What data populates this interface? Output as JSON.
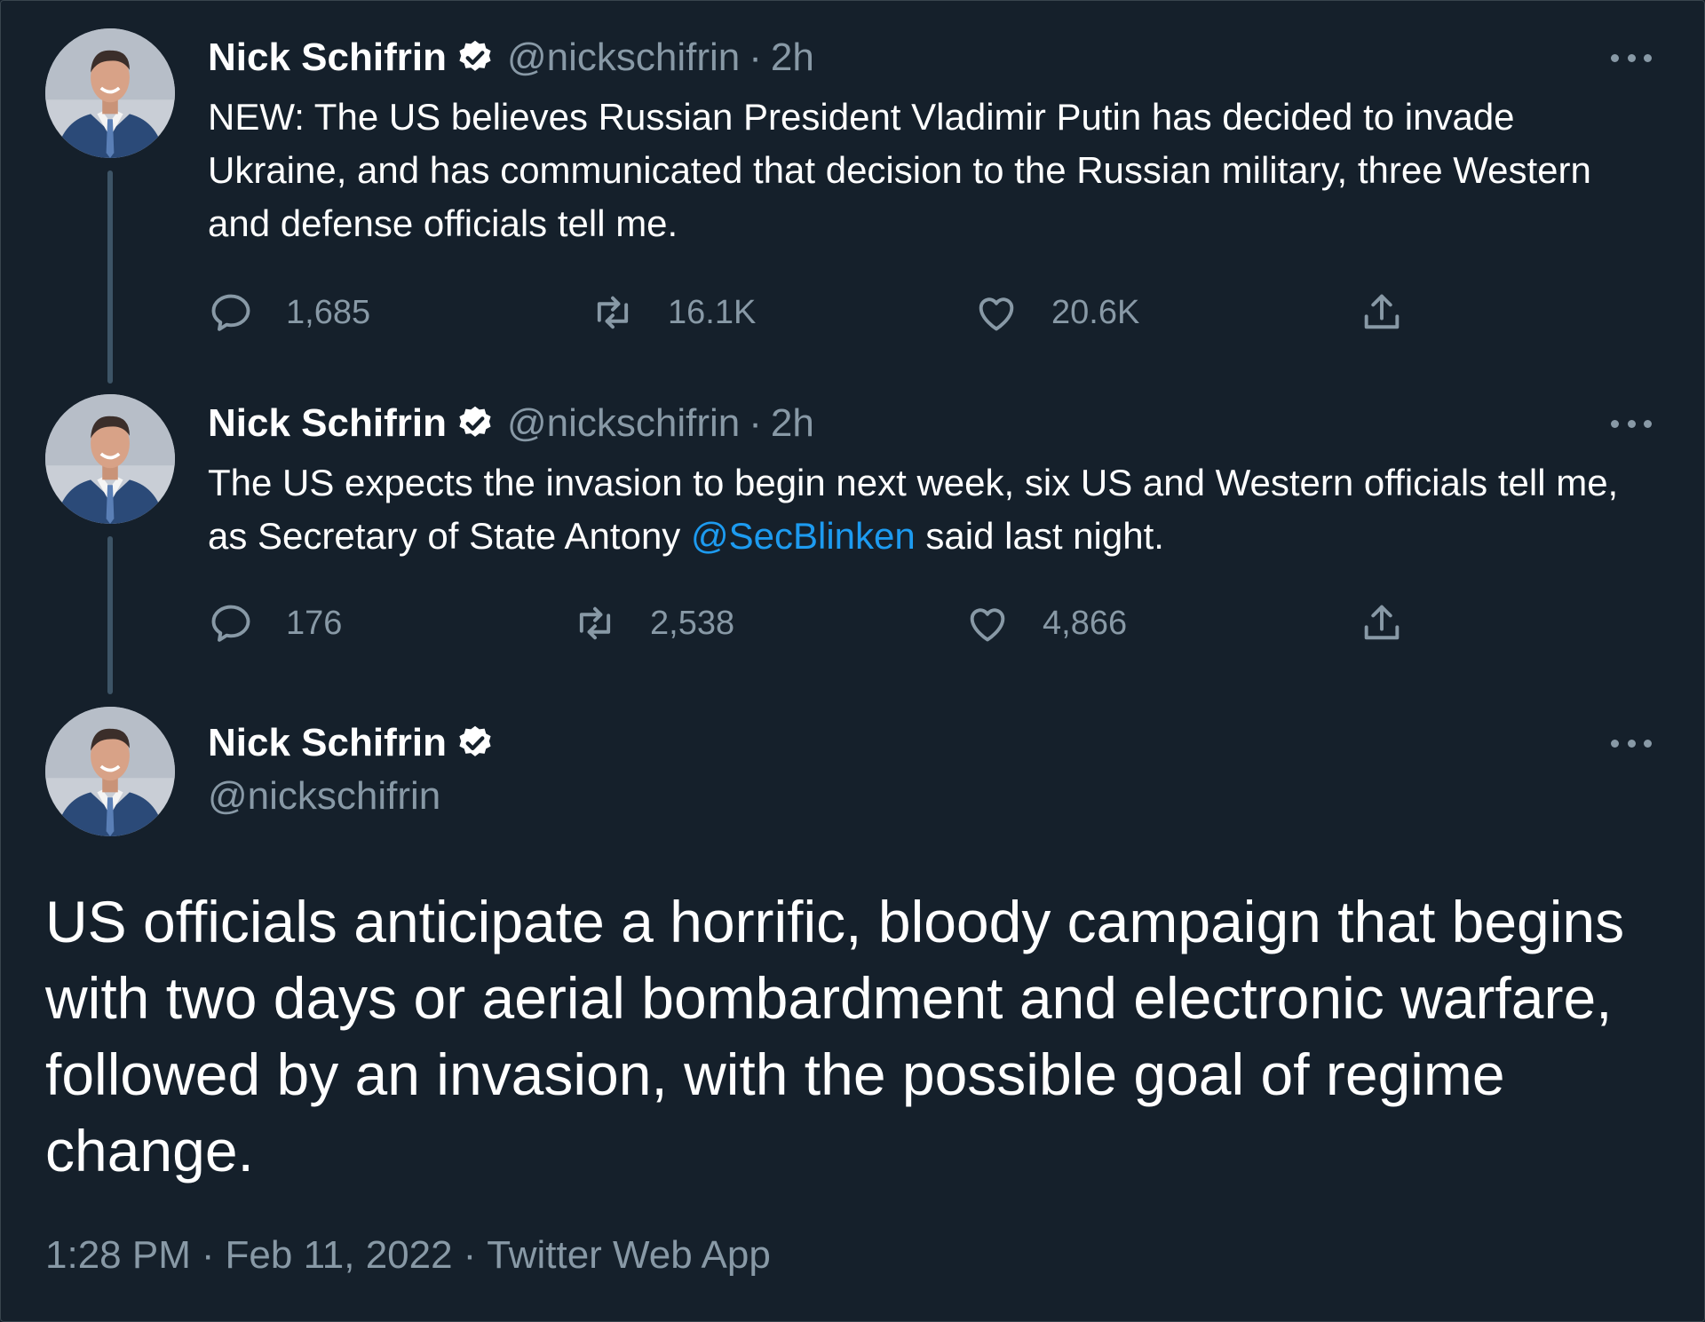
{
  "colors": {
    "background": "#15202b",
    "text": "#ffffff",
    "secondary": "#8899a6",
    "link": "#1d9bf0",
    "thread_line": "#3d5466"
  },
  "tweets": [
    {
      "author": "Nick Schifrin",
      "handle": "@nickschifrin",
      "separator": "·",
      "time": "2h",
      "text": "NEW: The US believes Russian President Vladimir Putin has decided to invade Ukraine, and has communicated that decision to the Russian military, three Western and defense officials tell me.",
      "replies": "1,685",
      "retweets": "16.1K",
      "likes": "20.6K"
    },
    {
      "author": "Nick Schifrin",
      "handle": "@nickschifrin",
      "separator": "·",
      "time": "2h",
      "text_before": "The US expects the invasion to begin next week, six US and Western officials tell me, as Secretary of State Antony ",
      "mention": "@SecBlinken",
      "text_after": " said last night.",
      "replies": "176",
      "retweets": "2,538",
      "likes": "4,866"
    }
  ],
  "main_tweet": {
    "author": "Nick Schifrin",
    "handle": "@nickschifrin",
    "text": "US officials anticipate a horrific, bloody campaign that begins with two days or aerial bombardment and electronic warfare, followed by an invasion, with the possible goal of regime change.",
    "time": "1:28 PM",
    "separator": "·",
    "date": "Feb 11, 2022",
    "source": "Twitter Web App"
  },
  "icons": {
    "verified": "verified-badge-icon",
    "reply": "reply-bubble-icon",
    "retweet": "retweet-arrows-icon",
    "like": "heart-icon",
    "share": "share-upload-icon",
    "more": "more-dots-icon"
  }
}
